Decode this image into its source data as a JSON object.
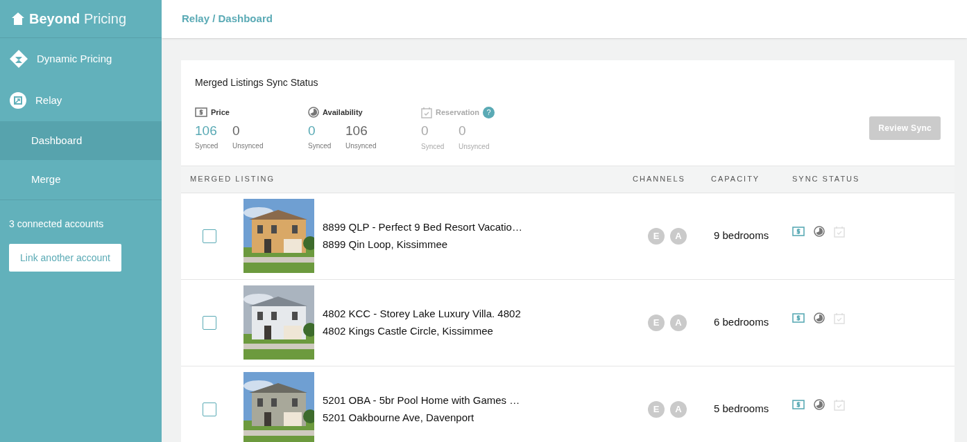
{
  "sidebar": {
    "brand": {
      "bold": "Beyond",
      "light": "Pricing"
    },
    "items": [
      {
        "label": "Dynamic Pricing",
        "selected": false
      },
      {
        "label": "Relay",
        "selected": false,
        "children": [
          {
            "label": "Dashboard",
            "selected": true
          },
          {
            "label": "Merge",
            "selected": false
          }
        ]
      }
    ],
    "accounts_text": "3 connected accounts",
    "link_button": "Link another account"
  },
  "breadcrumb": "Relay / Dashboard",
  "sync_summary": {
    "title": "Merged Listings Sync Status",
    "metrics": [
      {
        "kind": "price",
        "label": "Price",
        "disabled": false,
        "synced": "106",
        "synced_label": "Synced",
        "unsynced": "0",
        "unsynced_label": "Unsynced"
      },
      {
        "kind": "availability",
        "label": "Availability",
        "disabled": false,
        "synced": "0",
        "synced_label": "Synced",
        "unsynced": "106",
        "unsynced_label": "Unsynced"
      },
      {
        "kind": "reservation",
        "label": "Reservation",
        "disabled": true,
        "help": "?",
        "synced": "0",
        "synced_label": "Synced",
        "unsynced": "0",
        "unsynced_label": "Unsynced"
      }
    ],
    "review_button": {
      "label": "Review Sync",
      "disabled": true
    }
  },
  "table": {
    "columns": [
      "MERGED LISTING",
      "CHANNELS",
      "CAPACITY",
      "SYNC STATUS"
    ],
    "rows": [
      {
        "checked": false,
        "title": "8899 QLP - Perfect 9 Bed Resort Vacatio…",
        "address": "8899 Qin Loop, Kissimmee",
        "channels": [
          "E",
          "A"
        ],
        "capacity": "9 bedrooms",
        "sync": [
          {
            "kind": "price",
            "synced": true,
            "disabled": false
          },
          {
            "kind": "availability",
            "synced": false,
            "disabled": false
          },
          {
            "kind": "reservation",
            "disabled": true
          }
        ]
      },
      {
        "checked": false,
        "title": "4802 KCC - Storey Lake Luxury Villa. 4802",
        "address": "4802 Kings Castle Circle, Kissimmee",
        "channels": [
          "E",
          "A"
        ],
        "capacity": "6 bedrooms",
        "sync": [
          {
            "kind": "price",
            "synced": true,
            "disabled": false
          },
          {
            "kind": "availability",
            "synced": false,
            "disabled": false
          },
          {
            "kind": "reservation",
            "disabled": true
          }
        ]
      },
      {
        "checked": false,
        "title": "5201 OBA - 5br Pool Home with Games …",
        "address": "5201 Oakbourne Ave, Davenport",
        "channels": [
          "E",
          "A"
        ],
        "capacity": "5 bedrooms",
        "sync": [
          {
            "kind": "price",
            "synced": true,
            "disabled": false
          },
          {
            "kind": "availability",
            "synced": false,
            "disabled": false
          },
          {
            "kind": "reservation",
            "disabled": true
          }
        ]
      }
    ]
  }
}
